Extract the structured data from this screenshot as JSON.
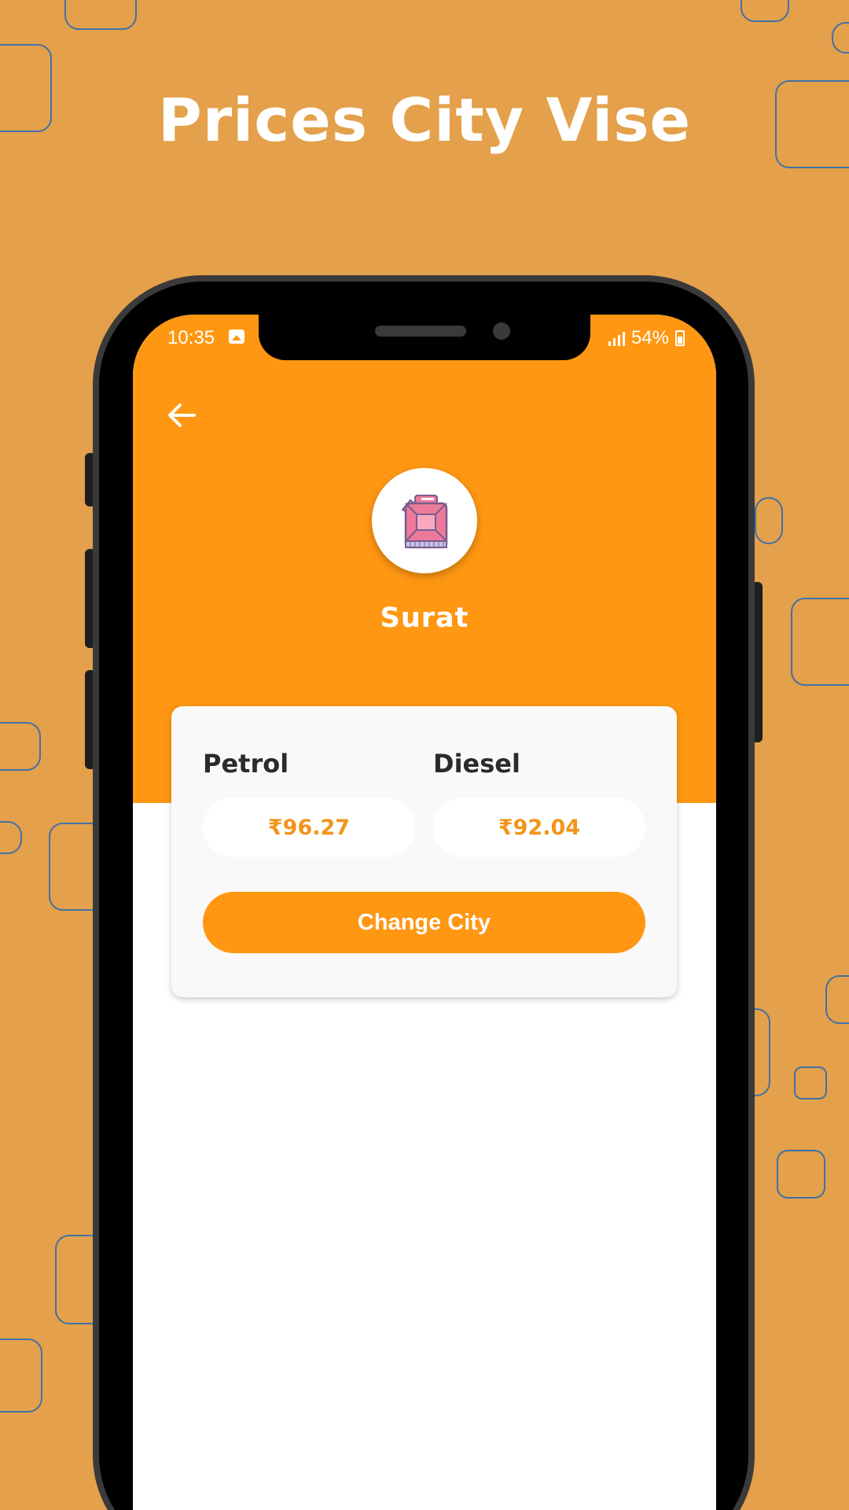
{
  "promo": {
    "title": "Prices City Vise"
  },
  "status_bar": {
    "time": "10:35",
    "battery": "54%"
  },
  "app": {
    "back_icon": "arrow-left-icon",
    "city_icon": "fuel-can-icon",
    "city_name": "Surat",
    "prices": {
      "petrol_label": "Petrol",
      "petrol_value": "₹96.27",
      "diesel_label": "Diesel",
      "diesel_value": "₹92.04"
    },
    "change_city_label": "Change City"
  },
  "colors": {
    "background": "#E4A04A",
    "accent": "#FF9712",
    "price_text": "#F2941A",
    "deco_outline": "#2F6CB3"
  }
}
